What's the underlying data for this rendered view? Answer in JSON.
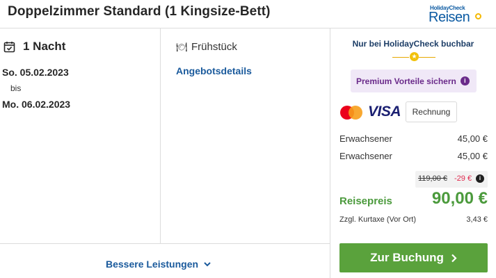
{
  "header": {
    "title": "Doppelzimmer Standard (1 Kingsize-Bett)",
    "logo_small": "HolidayCheck",
    "logo_big": "Reisen"
  },
  "stay": {
    "nights": "1 Nacht",
    "from": "So. 05.02.2023",
    "between": "bis",
    "to": "Mo. 06.02.2023"
  },
  "board": {
    "meal": "Frühstück",
    "details_link": "Angebotsdetails"
  },
  "footer": {
    "better_services": "Bessere Leistungen"
  },
  "booking": {
    "exclusive": "Nur bei HolidayCheck buchbar",
    "premium": "Premium Vorteile sichern",
    "payment": {
      "visa": "VISA",
      "invoice": "Rechnung"
    },
    "travelers": [
      {
        "label": "Erwachsener",
        "price": "45,00 €"
      },
      {
        "label": "Erwachsener",
        "price": "45,00 €"
      }
    ],
    "old_price": "119,00 €",
    "discount": "-29 €",
    "total_label": "Reisepreis",
    "total_value": "90,00 €",
    "tax_label": "Zzgl. Kurtaxe (Vor Ort)",
    "tax_value": "3,43 €",
    "cta": "Zur Buchung"
  },
  "colors": {
    "link_blue": "#1a5a9c",
    "price_green": "#4b9a3c",
    "cta_green": "#5aa23c",
    "premium_purple": "#6a2a8a",
    "premium_bg": "#f0e8f7",
    "discount_red": "#e0284d"
  },
  "icons": {
    "nights": "calendar-check-icon",
    "meal": "cutlery-icon",
    "better": "chevron-down-icon",
    "premium": "info-icon",
    "cta": "chevron-right-icon"
  }
}
